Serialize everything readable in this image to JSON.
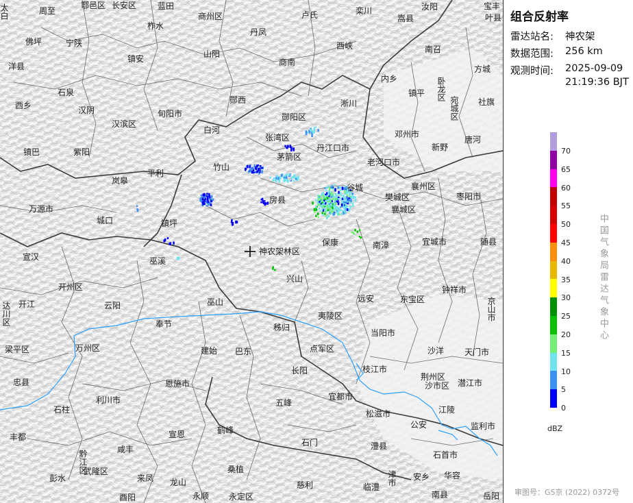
{
  "panel": {
    "title": "组合反射率",
    "station_label": "雷达站名:",
    "station_value": "神农架",
    "range_label": "数据范围:",
    "range_value": "256 km",
    "time_label": "观测时间:",
    "time_date": "2025-09-09",
    "time_clock": "21:19:36 BJT",
    "unit": "dBZ",
    "organization": "中国气象局雷达气象中心",
    "approval": "审图号：GS京 (2022) 0372号",
    "colorbar": [
      {
        "label": "70",
        "color": "#b19ce0"
      },
      {
        "label": "65",
        "color": "#8f00a0"
      },
      {
        "label": "60",
        "color": "#ff00f0"
      },
      {
        "label": "55",
        "color": "#c00000"
      },
      {
        "label": "50",
        "color": "#d60000"
      },
      {
        "label": "45",
        "color": "#ff0000"
      },
      {
        "label": "40",
        "color": "#ff8f00"
      },
      {
        "label": "35",
        "color": "#e8b800"
      },
      {
        "label": "30",
        "color": "#ffff00"
      },
      {
        "label": "25",
        "color": "#008f00"
      },
      {
        "label": "20",
        "color": "#00c000"
      },
      {
        "label": "15",
        "color": "#73f073"
      },
      {
        "label": "10",
        "color": "#6fe4ee"
      },
      {
        "label": "5",
        "color": "#3c8ff0"
      },
      {
        "label": "0",
        "color": "#0000f6"
      }
    ]
  },
  "map": {
    "radar_site": "神农架林区",
    "places": [
      {
        "name": "太白"
      },
      {
        "name": "周至"
      },
      {
        "name": "鄠邑区"
      },
      {
        "name": "长安区"
      },
      {
        "name": "蓝田"
      },
      {
        "name": "商州区"
      },
      {
        "name": "卢氏"
      },
      {
        "name": "栾川"
      },
      {
        "name": "嵩县"
      },
      {
        "name": "汝阳"
      },
      {
        "name": "宝丰"
      },
      {
        "name": "佛坪"
      },
      {
        "name": "宁陕"
      },
      {
        "name": "柞水"
      },
      {
        "name": "丹凤"
      },
      {
        "name": "西峡"
      },
      {
        "name": "南召"
      },
      {
        "name": "叶县"
      },
      {
        "name": "洋县"
      },
      {
        "name": "镇安"
      },
      {
        "name": "山阳"
      },
      {
        "name": "商南"
      },
      {
        "name": "方城"
      },
      {
        "name": "石泉"
      },
      {
        "name": "内乡"
      },
      {
        "name": "西乡"
      },
      {
        "name": "汉阴"
      },
      {
        "name": "旬阳市"
      },
      {
        "name": "郧西"
      },
      {
        "name": "淅川"
      },
      {
        "name": "镇平"
      },
      {
        "name": "卧龙区"
      },
      {
        "name": "宛城区"
      },
      {
        "name": "社旗"
      },
      {
        "name": "汉滨区"
      },
      {
        "name": "白河"
      },
      {
        "name": "郧阳区"
      },
      {
        "name": "邓州市"
      },
      {
        "name": "唐河"
      },
      {
        "name": "镇巴"
      },
      {
        "name": "紫阳"
      },
      {
        "name": "张湾区"
      },
      {
        "name": "丹江口市"
      },
      {
        "name": "新野"
      },
      {
        "name": "茅箭区"
      },
      {
        "name": "老河口市"
      },
      {
        "name": "竹山"
      },
      {
        "name": "平利"
      },
      {
        "name": "岚皋"
      },
      {
        "name": "谷城"
      },
      {
        "name": "襄州区"
      },
      {
        "name": "枣阳市"
      },
      {
        "name": "房县"
      },
      {
        "name": "樊城区"
      },
      {
        "name": "万源市"
      },
      {
        "name": "襄城区"
      },
      {
        "name": "城口"
      },
      {
        "name": "镇坪"
      },
      {
        "name": "南漳"
      },
      {
        "name": "保康"
      },
      {
        "name": "宜城市"
      },
      {
        "name": "随县"
      },
      {
        "name": "宣汉"
      },
      {
        "name": "巫溪"
      },
      {
        "name": "兴山"
      },
      {
        "name": "钟祥市"
      },
      {
        "name": "开州区"
      },
      {
        "name": "远安"
      },
      {
        "name": "东宝区"
      },
      {
        "name": "京山市"
      },
      {
        "name": "达川区"
      },
      {
        "name": "开江"
      },
      {
        "name": "云阳"
      },
      {
        "name": "巫山"
      },
      {
        "name": "奉节"
      },
      {
        "name": "秭归"
      },
      {
        "name": "夷陵区"
      },
      {
        "name": "当阳市"
      },
      {
        "name": "梁平区"
      },
      {
        "name": "万州区"
      },
      {
        "name": "建始"
      },
      {
        "name": "巴东"
      },
      {
        "name": "点军区"
      },
      {
        "name": "沙洋"
      },
      {
        "name": "天门市"
      },
      {
        "name": "忠县"
      },
      {
        "name": "恩施市"
      },
      {
        "name": "长阳"
      },
      {
        "name": "枝江市"
      },
      {
        "name": "荆州区"
      },
      {
        "name": "潜江市"
      },
      {
        "name": "石柱"
      },
      {
        "name": "利川市"
      },
      {
        "name": "宜都市"
      },
      {
        "name": "沙市区"
      },
      {
        "name": "五峰"
      },
      {
        "name": "江陵"
      },
      {
        "name": "丰都"
      },
      {
        "name": "宣恩"
      },
      {
        "name": "鹤峰"
      },
      {
        "name": "松滋市"
      },
      {
        "name": "公安"
      },
      {
        "name": "监利市"
      },
      {
        "name": "咸丰"
      },
      {
        "name": "石门"
      },
      {
        "name": "澧县"
      },
      {
        "name": "石首市"
      },
      {
        "name": "黔江区"
      },
      {
        "name": "桑植"
      },
      {
        "name": "武隆区"
      },
      {
        "name": "彭水"
      },
      {
        "name": "来凤"
      },
      {
        "name": "龙山"
      },
      {
        "name": "津市"
      },
      {
        "name": "安乡"
      },
      {
        "name": "华容"
      },
      {
        "name": "慈利"
      },
      {
        "name": "临澧"
      },
      {
        "name": "酉阳"
      },
      {
        "name": "永顺"
      },
      {
        "name": "永定区"
      },
      {
        "name": "南县"
      },
      {
        "name": "岳阳"
      }
    ]
  }
}
